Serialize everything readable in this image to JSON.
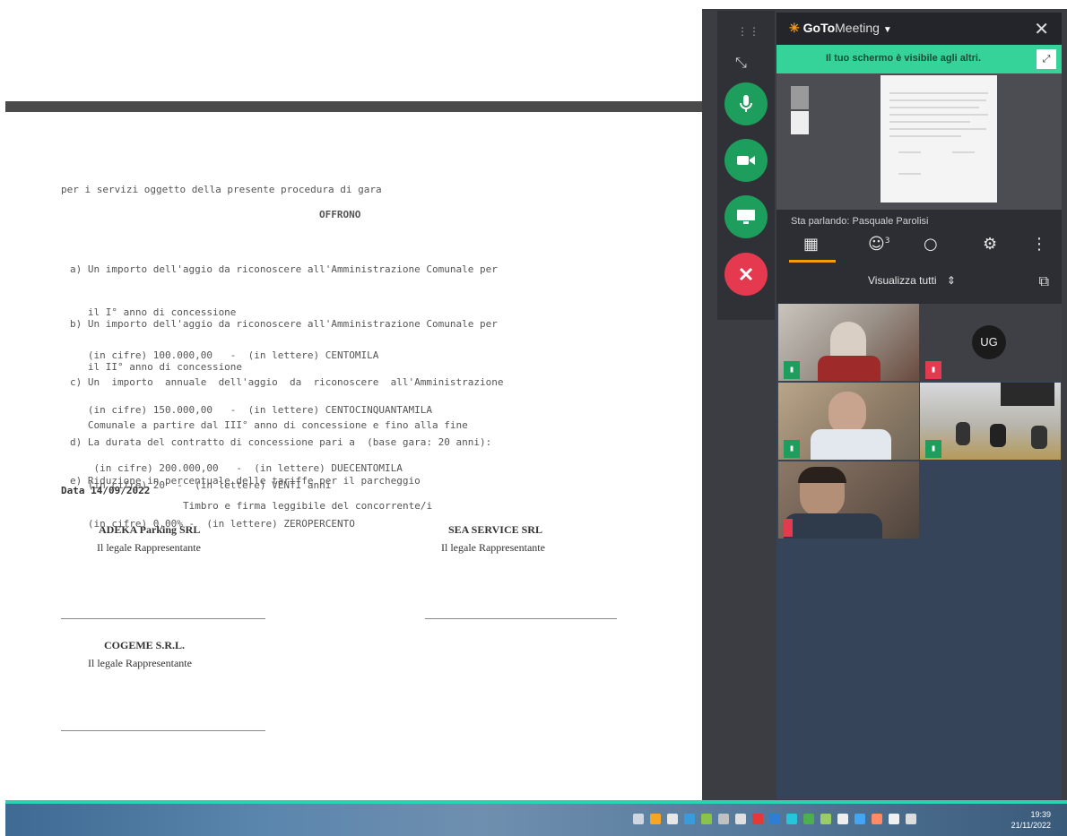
{
  "document": {
    "intro": "per i servizi oggetto della presente procedura di gara",
    "heading": "OFFRONO",
    "items": [
      {
        "lines": [
          "a) Un importo dell'aggio da riconoscere all'Amministrazione Comunale per",
          "   il I° anno di concessione",
          "   (in cifre) 100.000,00   -  (in lettere) CENTOMILA"
        ]
      },
      {
        "lines": [
          "b) Un importo dell'aggio da riconoscere all'Amministrazione Comunale per",
          "   il II° anno di concessione",
          "   (in cifre) 150.000,00   -  (in lettere) CENTOCINQUANTAMILA"
        ]
      },
      {
        "lines": [
          "c) Un  importo  annuale  dell'aggio  da  riconoscere  all'Amministrazione",
          "   Comunale a partire dal III° anno di concessione e fino alla fine",
          "    (in cifre) 200.000,00   -  (in lettere) DUECENTOMILA"
        ]
      },
      {
        "lines": [
          "d) La durata del contratto di concessione pari a  (base gara: 20 anni):",
          "   (in cifre) 20  -  (in lettere) VENTI anni"
        ]
      },
      {
        "lines": [
          "e) Riduzione in percentuale delle tariffe per il parcheggio",
          "   (in cifre) 0,00% -  (in lettere) ZEROPERCENTO"
        ]
      }
    ],
    "date": "Data 14/09/2022",
    "signature_caption": "Timbro e firma leggibile del concorrente/i",
    "companies": [
      {
        "name": "ADEKA Parking SRL",
        "role": "Il legale Rappresentante"
      },
      {
        "name": "SEA SERVICE SRL",
        "role": "Il legale Rappresentante"
      },
      {
        "name": "COGEME S.R.L.",
        "role": "Il legale Rappresentante"
      }
    ]
  },
  "meeting": {
    "app_name": "GoTo",
    "app_name_suffix": "Meeting",
    "banner": "Il tuo schermo è visibile agli altri.",
    "speaking": "Sta parlando: Pasquale Parolisi",
    "participants_count": "3",
    "view_selector": "Visualizza tutti",
    "avatar_initials": "UG"
  },
  "controls": [
    "mic-icon",
    "camera-icon",
    "screen-share-icon",
    "leave-icon"
  ],
  "taskbar": {
    "time": "19:39",
    "date": "21/11/2022"
  }
}
